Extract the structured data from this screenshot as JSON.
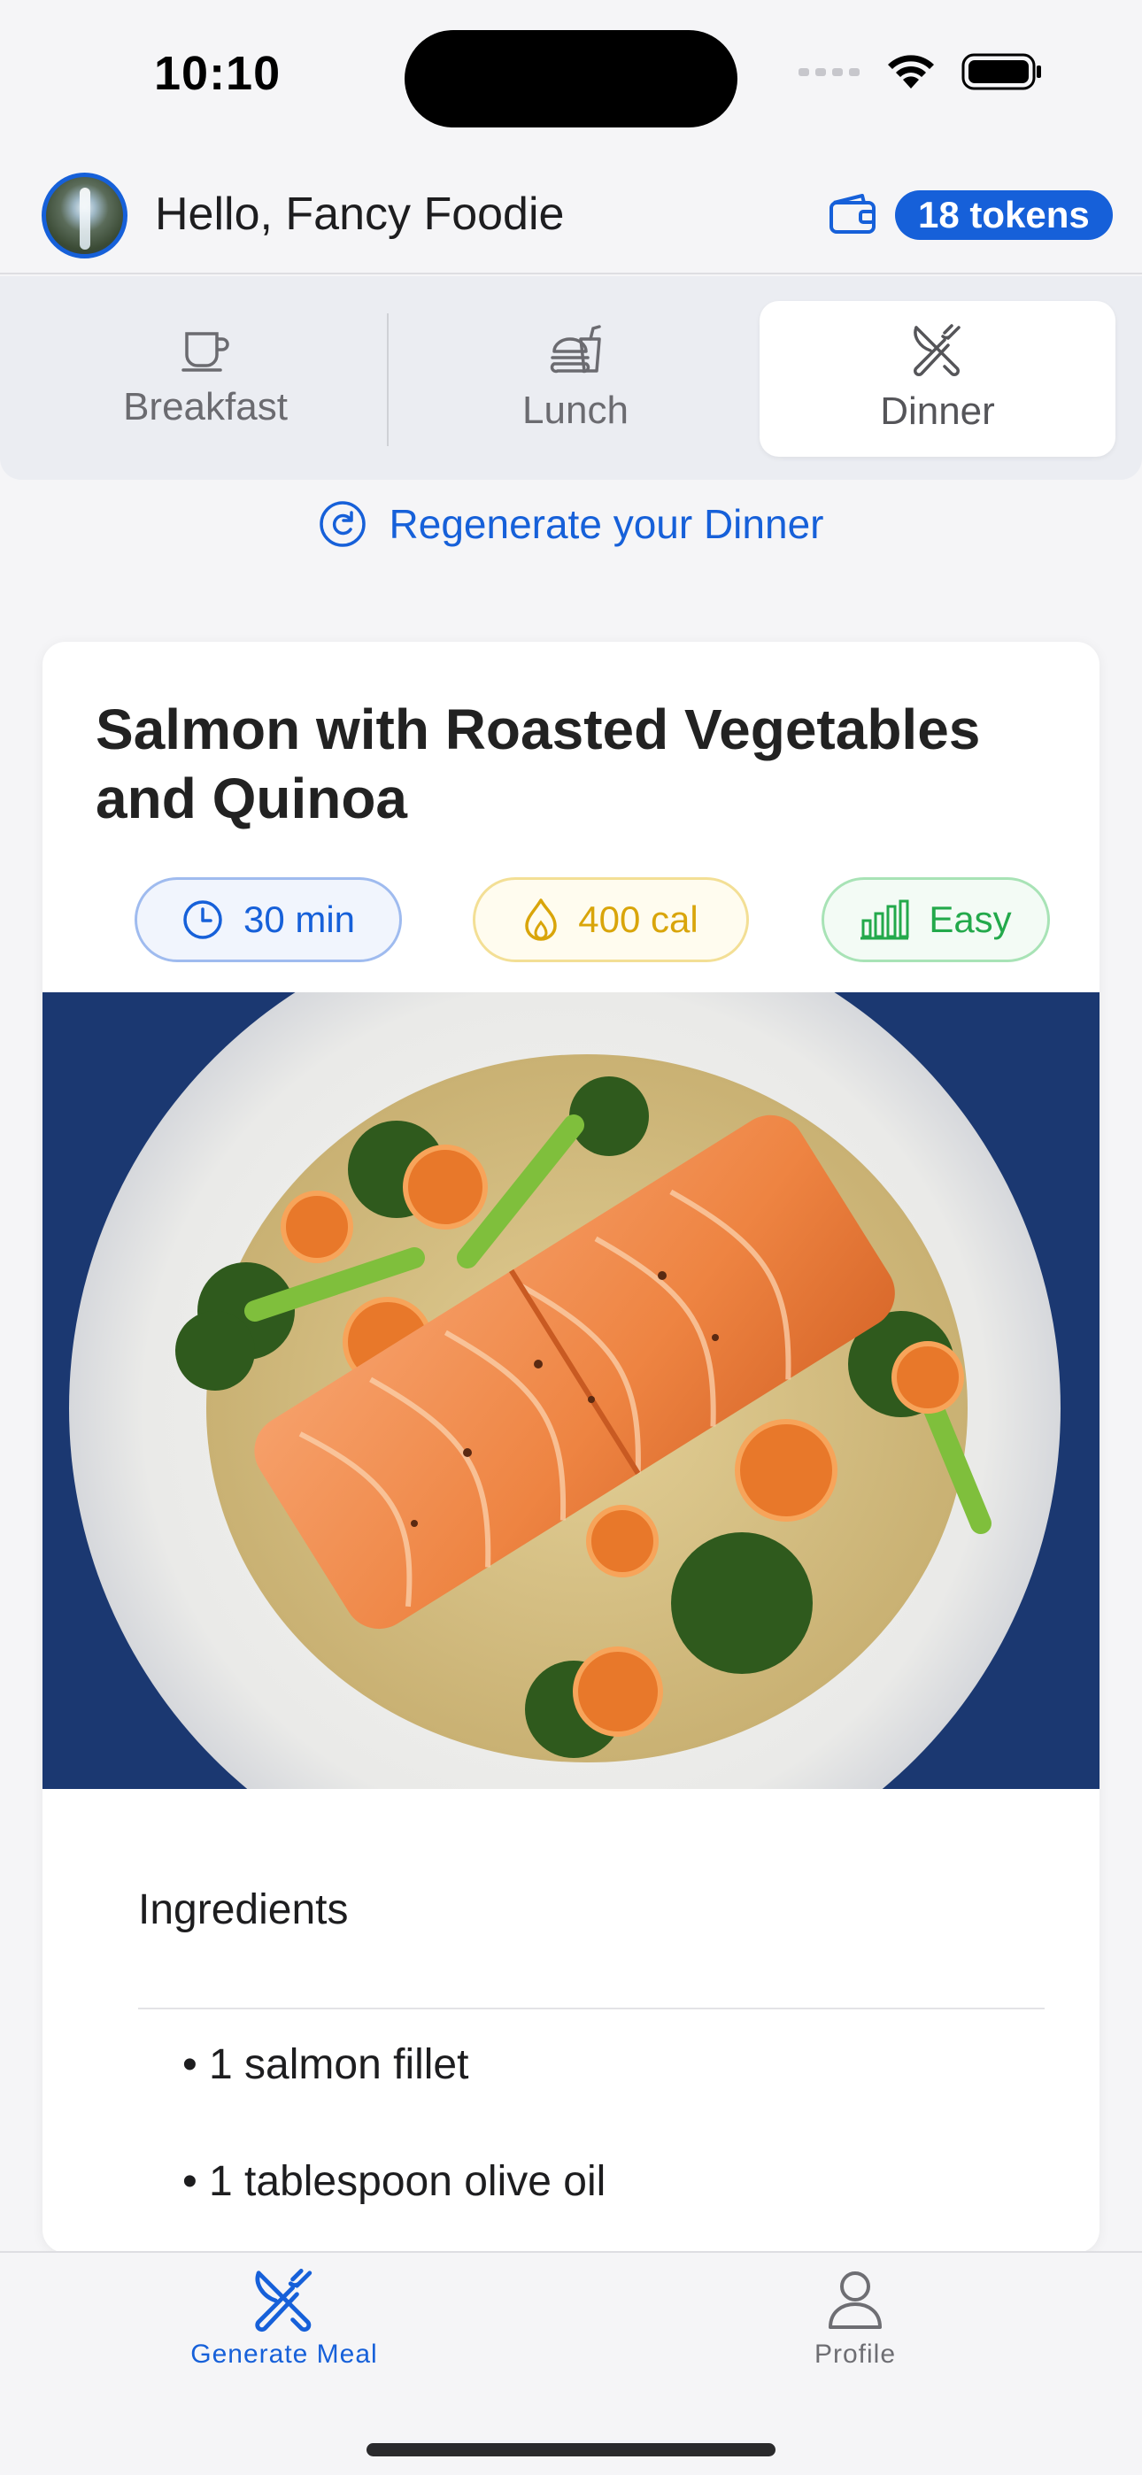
{
  "status_bar": {
    "time": "10:10"
  },
  "header": {
    "greeting": "Hello, Fancy Foodie",
    "tokens": "18 tokens",
    "accent": "#1660d9"
  },
  "meal_tabs": [
    {
      "label": "Breakfast",
      "icon": "coffee-cup-icon",
      "selected": false
    },
    {
      "label": "Lunch",
      "icon": "burger-drink-icon",
      "selected": false
    },
    {
      "label": "Dinner",
      "icon": "fork-knife-icon",
      "selected": true
    }
  ],
  "regenerate": {
    "label": "Regenerate your Dinner",
    "icon": "refresh-icon"
  },
  "recipe": {
    "title": "Salmon with Roasted Vegetables and Quinoa",
    "time": "30 min",
    "calories": "400 cal",
    "difficulty": "Easy",
    "colors": {
      "time": "#1660d9",
      "calories": "#d9a50a",
      "difficulty": "#23a94b"
    }
  },
  "ingredients": {
    "heading": "Ingredients",
    "items": [
      "1 salmon fillet",
      "1 tablespoon olive oil"
    ]
  },
  "tabbar": {
    "items": [
      {
        "label": "Generate Meal",
        "icon": "fork-knife-icon",
        "active": true
      },
      {
        "label": "Profile",
        "icon": "person-icon",
        "active": false
      }
    ]
  }
}
